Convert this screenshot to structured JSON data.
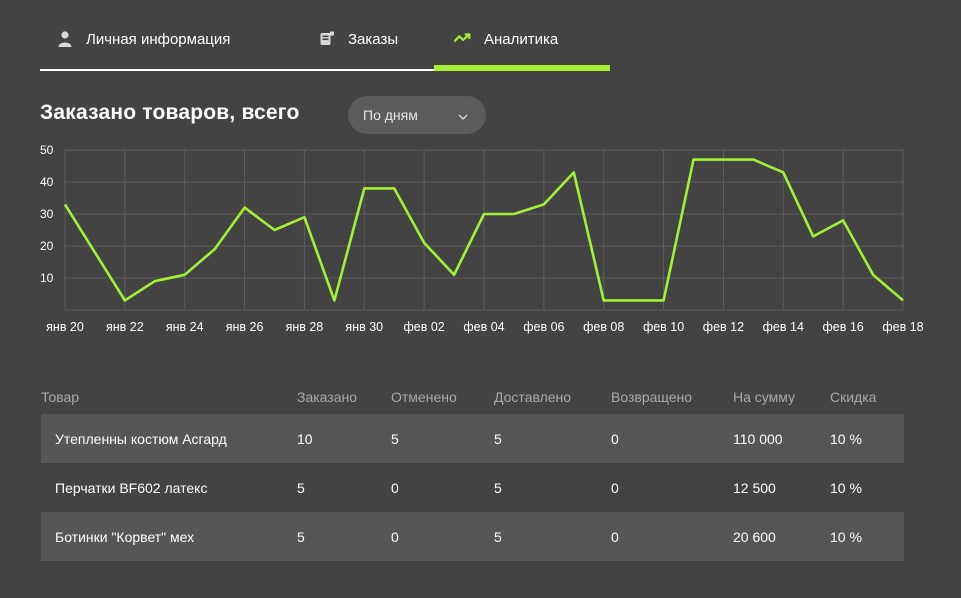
{
  "tabs": [
    {
      "label": "Личная информация",
      "icon": "user-icon"
    },
    {
      "label": "Заказы",
      "icon": "orders-icon"
    },
    {
      "label": "Аналитика",
      "icon": "trend-icon"
    }
  ],
  "active_tab": "Аналитика",
  "colors": {
    "accent": "#a5f035",
    "background": "#434343",
    "row_shade": "#565656"
  },
  "section": {
    "title": "Заказано товаров, всего",
    "period_select": "По дням"
  },
  "chart_data": {
    "type": "line",
    "x_tick_labels": [
      "янв 20",
      "янв 22",
      "янв 24",
      "янв 26",
      "янв 28",
      "янв 30",
      "фев 02",
      "фев 04",
      "фев 06",
      "фев 08",
      "фев 10",
      "фев 12",
      "фев 14",
      "фев 16",
      "фев 18"
    ],
    "y_ticks": [
      10,
      20,
      30,
      40,
      50
    ],
    "ylim": [
      0,
      50
    ],
    "values": [
      33,
      18,
      3,
      9,
      11,
      19,
      32,
      25,
      29,
      3,
      38,
      38,
      21,
      11,
      30,
      30,
      33,
      43,
      3,
      3,
      3,
      47,
      47,
      47,
      43,
      23,
      28,
      11,
      3
    ],
    "grid": true,
    "line_color": "#a5f035"
  },
  "table": {
    "headers": [
      "Товар",
      "Заказано",
      "Отменено",
      "Доставлено",
      "Возвращено",
      "На сумму",
      "Скидка"
    ],
    "rows": [
      [
        "Утепленны костюм Асгард",
        "10",
        "5",
        "5",
        "0",
        "110 000",
        "10 %"
      ],
      [
        "Перчатки BF602 латекс",
        "5",
        "0",
        "5",
        "0",
        "12 500",
        "10 %"
      ],
      [
        "Ботинки \"Корвет\" мех",
        "5",
        "0",
        "5",
        "0",
        "20 600",
        "10 %"
      ]
    ]
  }
}
